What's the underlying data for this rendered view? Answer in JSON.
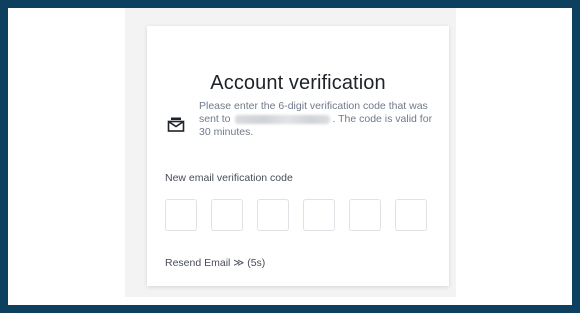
{
  "verification": {
    "title": "Account verification",
    "message_before": "Please enter the 6-digit verification code that was sent to",
    "message_after": ". The code is valid for 30 minutes.",
    "code_label": "New email verification code",
    "code_digits": [
      "",
      "",
      "",
      "",
      "",
      ""
    ],
    "resend_label": "Resend Email",
    "resend_arrow": "≫",
    "resend_countdown": "(5s)"
  },
  "icons": {
    "info": "email-envelope-icon"
  },
  "colors": {
    "frame_border": "#0d3f5f",
    "title_text": "#1e2329",
    "muted_text": "#707a8a"
  }
}
